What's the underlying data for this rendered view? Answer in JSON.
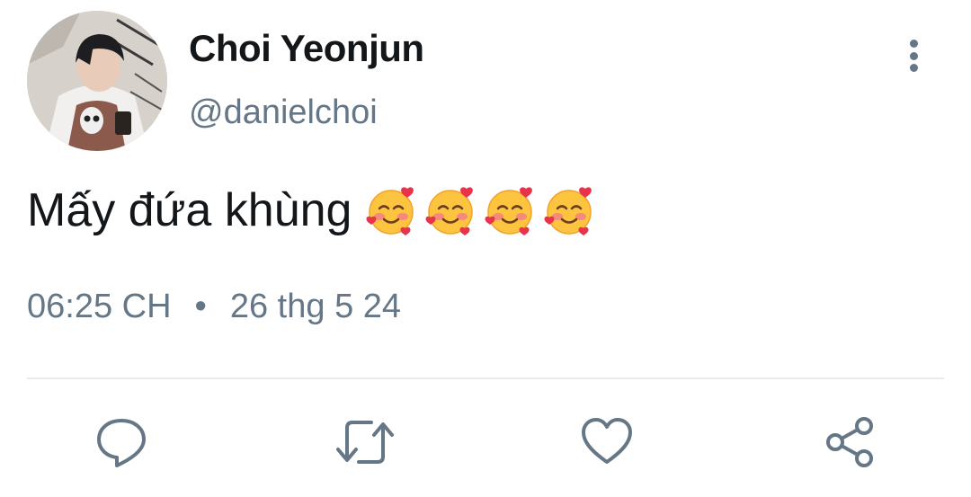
{
  "author": {
    "display_name": "Choi Yeonjun",
    "handle": "@danielchoi"
  },
  "tweet": {
    "text": "Mấy đứa khùng",
    "emoji": [
      "smiling-face-with-hearts-icon",
      "smiling-face-with-hearts-icon",
      "smiling-face-with-hearts-icon",
      "smiling-face-with-hearts-icon"
    ]
  },
  "meta": {
    "time": "06:25 CH",
    "separator": "•",
    "date": "26 thg 5 24"
  },
  "actions": [
    "reply-icon",
    "retweet-icon",
    "like-icon",
    "share-icon"
  ],
  "colors": {
    "text_primary": "#14171a",
    "text_secondary": "#657786",
    "divider": "#e6ecf0"
  }
}
